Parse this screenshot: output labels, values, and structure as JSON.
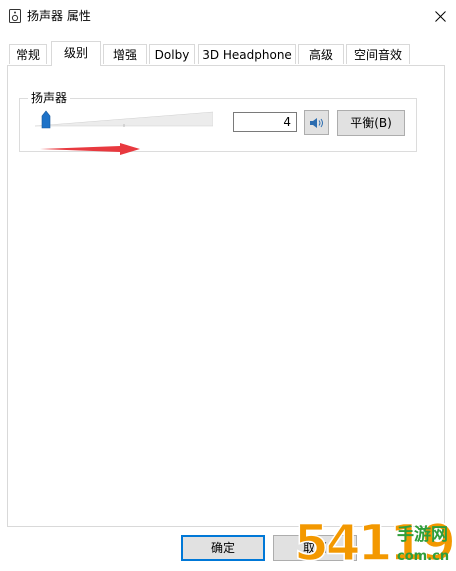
{
  "window": {
    "title": "扬声器 属性",
    "icon": "speaker-icon"
  },
  "tabs": [
    {
      "label": "常规",
      "active": false
    },
    {
      "label": "级别",
      "active": true
    },
    {
      "label": "增强",
      "active": false
    },
    {
      "label": "Dolby",
      "active": false
    },
    {
      "label": "3D Headphone",
      "active": false
    },
    {
      "label": "高级",
      "active": false
    },
    {
      "label": "空间音效",
      "active": false
    }
  ],
  "levels": {
    "group_label": "扬声器",
    "level_value": "4",
    "slider_fraction": 0.04,
    "mute_icon": "speaker-volume-icon",
    "balance_label": "平衡(B)"
  },
  "annotation": {
    "arrow_color": "#e8393f"
  },
  "buttons": {
    "ok_label": "确定",
    "cancel_label": "取消"
  },
  "watermark": {
    "text_main": "54119",
    "text_cn": "手游网",
    "text_url": "com.cn",
    "colors": {
      "orange": "#f39800",
      "green": "#2f9e3a"
    }
  }
}
